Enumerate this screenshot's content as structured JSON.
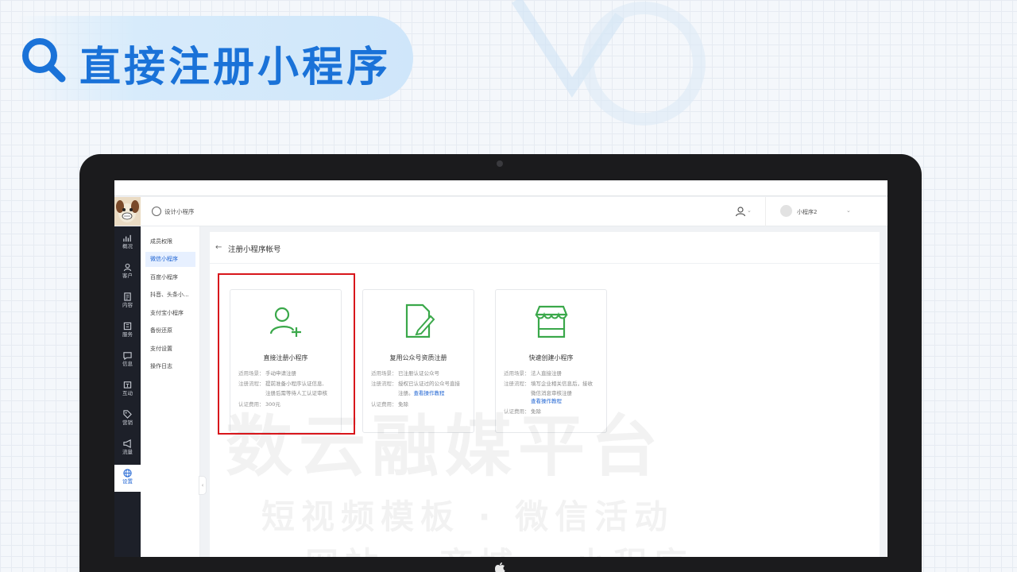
{
  "slide": {
    "title": "直接注册小程序"
  },
  "app": {
    "project_name": "设计小程序",
    "account_name": "小程序2"
  },
  "nav": [
    {
      "label": "概况",
      "icon": "chart-icon"
    },
    {
      "label": "客户",
      "icon": "user-icon"
    },
    {
      "label": "内容",
      "icon": "document-icon"
    },
    {
      "label": "服务",
      "icon": "service-icon"
    },
    {
      "label": "信息",
      "icon": "message-icon"
    },
    {
      "label": "互动",
      "icon": "interaction-icon"
    },
    {
      "label": "营销",
      "icon": "tag-icon"
    },
    {
      "label": "流量",
      "icon": "megaphone-icon"
    },
    {
      "label": "设置",
      "icon": "globe-icon",
      "active": true
    }
  ],
  "subnav": [
    {
      "label": "成员权限"
    },
    {
      "label": "微信小程序",
      "active": true
    },
    {
      "label": "百度小程序"
    },
    {
      "label": "抖音、头条小..."
    },
    {
      "label": "支付宝小程序"
    },
    {
      "label": "备份还原"
    },
    {
      "label": "支付设置"
    },
    {
      "label": "操作日志"
    }
  ],
  "page": {
    "back_icon": "arrow-left-icon",
    "title": "注册小程序帐号"
  },
  "cards": [
    {
      "title": "直接注册小程序",
      "icon": "add-user-icon",
      "scene_label": "适用场景：",
      "scene": "手动申请注册",
      "flow_label": "注册流程：",
      "flow_1": "提前准备小程序认证信息,",
      "flow_2": "注册后需等待人工认证审核",
      "fee_label": "认证费用：",
      "fee": "300元"
    },
    {
      "title": "复用公众号资质注册",
      "icon": "edit-document-icon",
      "scene_label": "适用场景：",
      "scene": "已注册认证公众号",
      "flow_label": "注册流程：",
      "flow_1": "授权已认证过的公众号直接",
      "flow_2": "注册。",
      "link": "查看操作教程",
      "fee_label": "认证费用：",
      "fee": "免除"
    },
    {
      "title": "快速创建小程序",
      "icon": "store-icon",
      "scene_label": "适用场景：",
      "scene": "法人直接注册",
      "flow_label": "注册流程：",
      "flow_1": "填写企业相关信息后，接收",
      "flow_2": "微信消息审核注册",
      "link": "查看操作教程",
      "fee_label": "认证费用：",
      "fee": "免除"
    }
  ],
  "watermark": {
    "line1": "数云融媒平台",
    "line2": "短视频模板 · 微信活动",
    "line3": "网站 · 商城 · 小程序"
  },
  "colors": {
    "accent": "#1f64d3",
    "green": "#3aa84a",
    "highlight": "#d8161b",
    "title_blue": "#1a72d8"
  }
}
